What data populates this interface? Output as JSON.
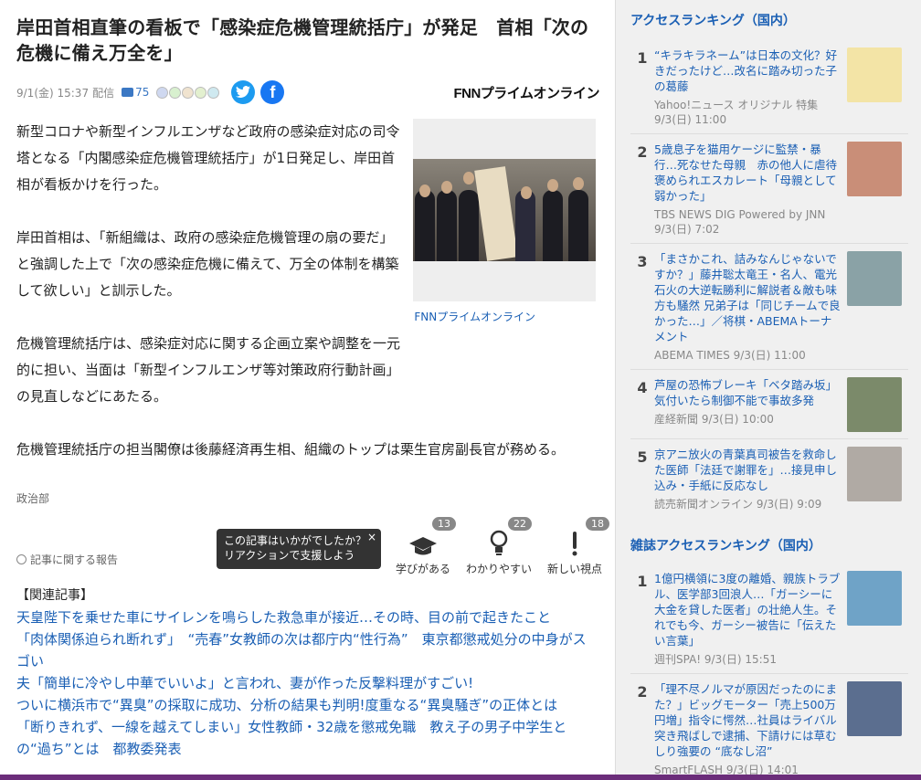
{
  "article": {
    "title": "岸田首相直筆の看板で「感染症危機管理統括庁」が発足　首相「次の危機に備え万全を」",
    "date": "9/1(金) 15:37",
    "date_suffix": "配信",
    "comment_count": "75",
    "publisher": "FNNプライムオンライン",
    "photo_caption": "FNNプライムオンライン",
    "paragraphs": [
      "新型コロナや新型インフルエンザなど政府の感染症対応の司令塔となる「内閣感染症危機管理統括庁」が1日発足し、岸田首相が看板かけを行った。",
      "岸田首相は、「新組織は、政府の感染症危機管理の扇の要だ」と強調した上で「次の感染症危機に備えて、万全の体制を構築して欲しい」と訓示した。",
      "危機管理統括庁は、感染症対応に関する企画立案や調整を一元的に担い、当面は「新型インフルエンザ等対策政府行動計画」の見直しなどにあたる。",
      "危機管理統括庁の担当閣僚は後藤経済再生相、組織のトップは栗生官房副長官が務める。"
    ],
    "department": "政治部",
    "report_label": "記事に関する報告",
    "tooltip": {
      "line1": "この記事はいかがでしたか？",
      "line2": "リアクションで支援しよう",
      "close": "×"
    },
    "reactions": [
      {
        "label": "学びがある",
        "count": "13",
        "icon": "graduation-cap-icon"
      },
      {
        "label": "わかりやすい",
        "count": "22",
        "icon": "lightbulb-icon"
      },
      {
        "label": "新しい視点",
        "count": "18",
        "icon": "exclamation-icon"
      }
    ]
  },
  "related": {
    "heading": "【関連記事】",
    "links": [
      "天皇陛下を乗せた車にサイレンを鳴らした救急車が接近…その時、目の前で起きたこと",
      "「肉体関係迫られ断れず」　“売春”女教師の次は都庁内“性行為”　東京都懲戒処分の中身がスゴい",
      "夫「簡単に冷やし中華でいいよ」と言われ、妻が作った反撃料理がすごい!",
      "ついに横浜市で“異臭”の採取に成功、分析の結果も判明!度重なる“異臭騒ぎ”の正体とは",
      "「断りきれず、一線を越えてしまい」女性教師・32歳を懲戒免職　教え子の男子中学生との“過ち”とは　都教委発表"
    ]
  },
  "sidebar": {
    "ranking_title": "アクセスランキング（国内）",
    "ranking": [
      {
        "rank": "1",
        "headline": "“キラキラネーム”は日本の文化？好きだったけど…改名に踏み切った子の葛藤",
        "source": "Yahoo!ニュース オリジナル 特集",
        "time": "9/3(日) 11:00",
        "thumb": "#f3e4a6"
      },
      {
        "rank": "2",
        "headline": "5歳息子を猫用ケージに監禁・暴行…死なせた母親　赤の他人に虐待褒められエスカレート「母親として弱かった」",
        "source": "TBS NEWS DIG Powered by JNN",
        "time": "9/3(日) 7:02",
        "thumb": "#c98e78"
      },
      {
        "rank": "3",
        "headline": "「まさかこれ、詰みなんじゃないですか？」藤井聡太竜王・名人、電光石火の大逆転勝利に解説者＆敵も味方も騒然 兄弟子は「同じチームで良かった…」／将棋・ABEMAトーナメント",
        "source": "ABEMA TIMES 9/3(日) 11:00",
        "time": "",
        "thumb": "#8aa2a6"
      },
      {
        "rank": "4",
        "headline": "芦屋の恐怖ブレーキ「ベタ踏み坂」　気付いたら制御不能で事故多発",
        "source": "産経新聞 9/3(日) 10:00",
        "time": "",
        "thumb": "#7b8a6a"
      },
      {
        "rank": "5",
        "headline": "京アニ放火の青葉真司被告を救命した医師「法廷で謝罪を」…接見申し込み・手紙に反応なし",
        "source": "読売新聞オンライン 9/3(日) 9:09",
        "time": "",
        "thumb": "#b0aaa4"
      }
    ],
    "magazine_title": "雑誌アクセスランキング（国内）",
    "magazine": [
      {
        "rank": "1",
        "headline": "1億円横領に3度の離婚、親族トラブル、医学部3回浪人…「ガーシーに大金を貸した医者」の壮絶人生。それでも今、ガーシー被告に「伝えたい言葉」",
        "source": "週刊SPA! 9/3(日) 15:51",
        "time": "",
        "thumb": "#6fa3c7"
      },
      {
        "rank": "2",
        "headline": "「理不尽ノルマが原因だったのにまた？」ビッグモーター「売上500万円増」指令に愕然…社員はライバル突き飛ばしで逮捕、下請けには草むしり強要の “底なし沼”",
        "source": "SmartFLASH 9/3(日) 14:01",
        "time": "",
        "thumb": "#5b6e8f"
      }
    ]
  }
}
